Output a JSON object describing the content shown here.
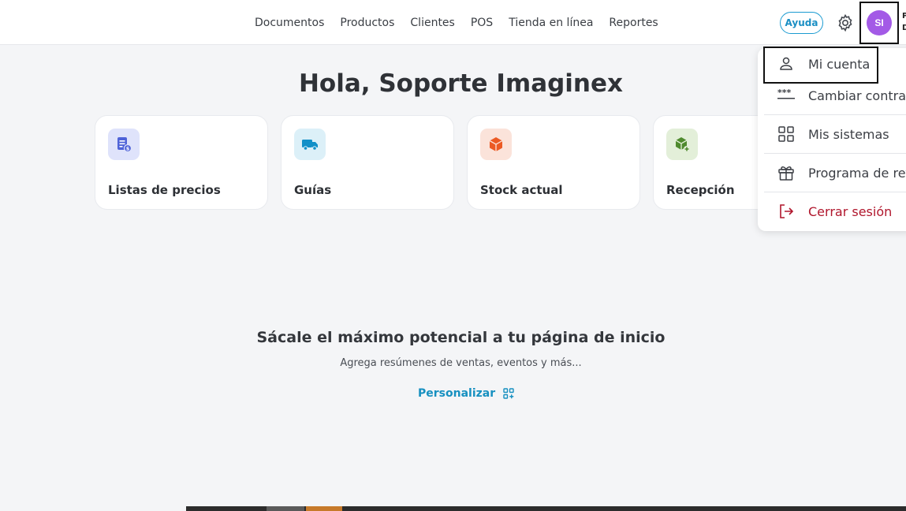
{
  "nav": {
    "items": [
      "Documentos",
      "Productos",
      "Clientes",
      "POS",
      "Tienda en línea",
      "Reportes"
    ]
  },
  "header": {
    "help_label": "Ayuda",
    "avatar_initials": "SI",
    "user_name_truncated": "P\nD"
  },
  "main": {
    "greeting": "Hola, Soporte Imaginex",
    "shortcuts": [
      {
        "label": "Listas de precios",
        "icon": "price-list-icon",
        "color": "#dfe3fb"
      },
      {
        "label": "Guías",
        "icon": "truck-icon",
        "color": "#dcf0f8"
      },
      {
        "label": "Stock actual",
        "icon": "box-icon",
        "color": "#fbe3da"
      },
      {
        "label": "Recepción",
        "icon": "box-add-icon",
        "color": "#e3efd9"
      }
    ],
    "empty_title": "Sácale el máximo potencial a tu página de inicio",
    "empty_subtitle": "Agrega resúmenes de ventas, eventos y más...",
    "personalize_label": "Personalizar"
  },
  "user_menu": {
    "items": [
      {
        "label": "Mi cuenta",
        "icon": "user-icon"
      },
      {
        "label": "Cambiar contras",
        "icon": "password-icon"
      },
      {
        "label": "Mis sistemas",
        "icon": "grid-icon"
      },
      {
        "label": "Programa de refe",
        "icon": "gift-icon"
      },
      {
        "label": "Cerrar sesión",
        "icon": "logout-icon",
        "color": "#b0162c"
      }
    ]
  },
  "colors": {
    "accent": "#1790c0",
    "avatar": "#a35ae6",
    "danger": "#b0162c"
  }
}
